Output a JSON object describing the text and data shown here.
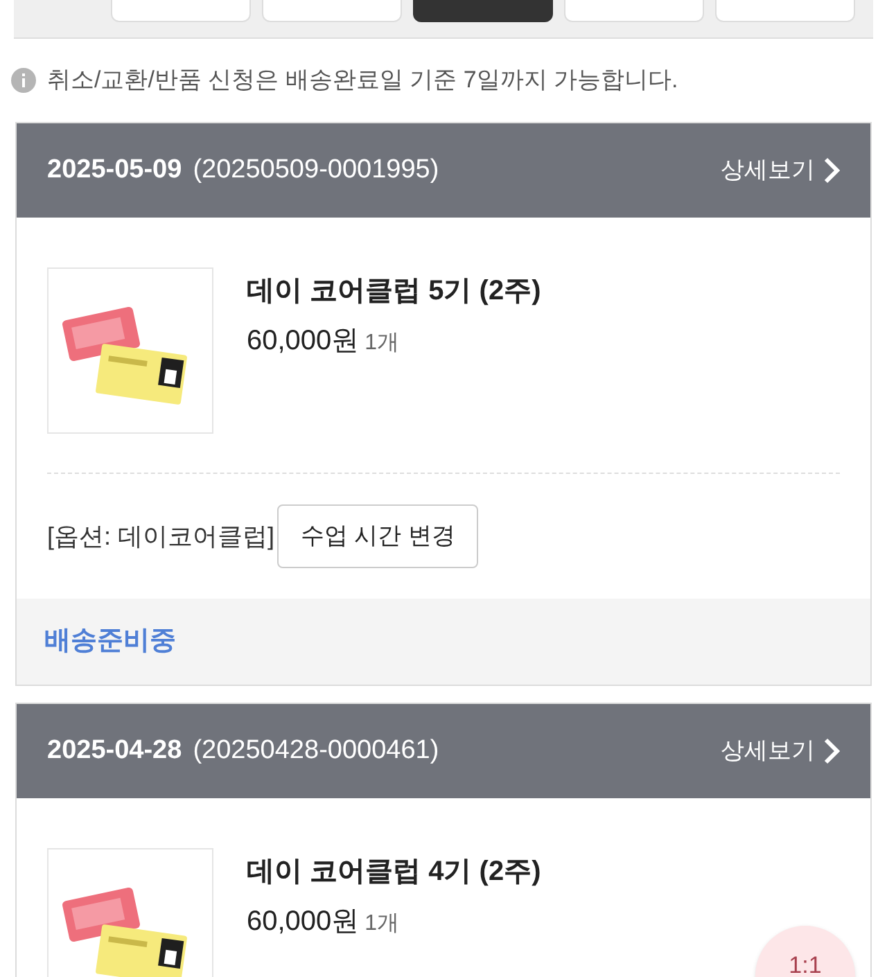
{
  "filter_buttons": [
    {
      "selected": false
    },
    {
      "selected": false
    },
    {
      "selected": true
    },
    {
      "selected": false
    },
    {
      "selected": false
    }
  ],
  "notice": "취소/교환/반품 신청은 배송완료일 기준 7일까지 가능합니다.",
  "orders": [
    {
      "date": "2025-05-09",
      "order_no": "(20250509-0001995)",
      "detail_link": "상세보기",
      "product": {
        "kind": "picture",
        "name": "데이 코어클럽 5기 (2주)",
        "price": "60,000원",
        "quantity": "1개"
      },
      "option": "[옵션: 데이코어클럽]",
      "action_button": "수업 시간 변경",
      "status": "배송준비중"
    },
    {
      "date": "2025-04-28",
      "order_no": "(20250428-0000461)",
      "detail_link": "상세보기",
      "product": {
        "kind": "picture",
        "name": "데이 코어클럽 4기 (2주)",
        "price": "60,000원",
        "quantity": "1개"
      }
    }
  ],
  "chat_button": "1:1"
}
